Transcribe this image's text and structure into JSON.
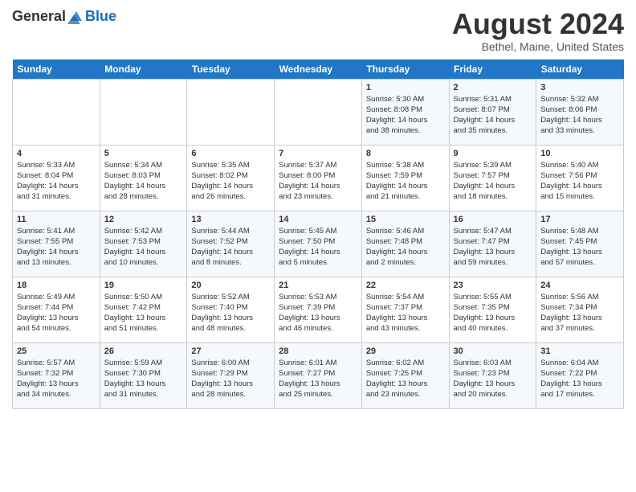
{
  "header": {
    "logo_general": "General",
    "logo_blue": "Blue",
    "month_title": "August 2024",
    "location": "Bethel, Maine, United States"
  },
  "weekdays": [
    "Sunday",
    "Monday",
    "Tuesday",
    "Wednesday",
    "Thursday",
    "Friday",
    "Saturday"
  ],
  "weeks": [
    [
      {
        "day": "",
        "info": ""
      },
      {
        "day": "",
        "info": ""
      },
      {
        "day": "",
        "info": ""
      },
      {
        "day": "",
        "info": ""
      },
      {
        "day": "1",
        "info": "Sunrise: 5:30 AM\nSunset: 8:08 PM\nDaylight: 14 hours\nand 38 minutes."
      },
      {
        "day": "2",
        "info": "Sunrise: 5:31 AM\nSunset: 8:07 PM\nDaylight: 14 hours\nand 35 minutes."
      },
      {
        "day": "3",
        "info": "Sunrise: 5:32 AM\nSunset: 8:06 PM\nDaylight: 14 hours\nand 33 minutes."
      }
    ],
    [
      {
        "day": "4",
        "info": "Sunrise: 5:33 AM\nSunset: 8:04 PM\nDaylight: 14 hours\nand 31 minutes."
      },
      {
        "day": "5",
        "info": "Sunrise: 5:34 AM\nSunset: 8:03 PM\nDaylight: 14 hours\nand 28 minutes."
      },
      {
        "day": "6",
        "info": "Sunrise: 5:35 AM\nSunset: 8:02 PM\nDaylight: 14 hours\nand 26 minutes."
      },
      {
        "day": "7",
        "info": "Sunrise: 5:37 AM\nSunset: 8:00 PM\nDaylight: 14 hours\nand 23 minutes."
      },
      {
        "day": "8",
        "info": "Sunrise: 5:38 AM\nSunset: 7:59 PM\nDaylight: 14 hours\nand 21 minutes."
      },
      {
        "day": "9",
        "info": "Sunrise: 5:39 AM\nSunset: 7:57 PM\nDaylight: 14 hours\nand 18 minutes."
      },
      {
        "day": "10",
        "info": "Sunrise: 5:40 AM\nSunset: 7:56 PM\nDaylight: 14 hours\nand 15 minutes."
      }
    ],
    [
      {
        "day": "11",
        "info": "Sunrise: 5:41 AM\nSunset: 7:55 PM\nDaylight: 14 hours\nand 13 minutes."
      },
      {
        "day": "12",
        "info": "Sunrise: 5:42 AM\nSunset: 7:53 PM\nDaylight: 14 hours\nand 10 minutes."
      },
      {
        "day": "13",
        "info": "Sunrise: 5:44 AM\nSunset: 7:52 PM\nDaylight: 14 hours\nand 8 minutes."
      },
      {
        "day": "14",
        "info": "Sunrise: 5:45 AM\nSunset: 7:50 PM\nDaylight: 14 hours\nand 5 minutes."
      },
      {
        "day": "15",
        "info": "Sunrise: 5:46 AM\nSunset: 7:48 PM\nDaylight: 14 hours\nand 2 minutes."
      },
      {
        "day": "16",
        "info": "Sunrise: 5:47 AM\nSunset: 7:47 PM\nDaylight: 13 hours\nand 59 minutes."
      },
      {
        "day": "17",
        "info": "Sunrise: 5:48 AM\nSunset: 7:45 PM\nDaylight: 13 hours\nand 57 minutes."
      }
    ],
    [
      {
        "day": "18",
        "info": "Sunrise: 5:49 AM\nSunset: 7:44 PM\nDaylight: 13 hours\nand 54 minutes."
      },
      {
        "day": "19",
        "info": "Sunrise: 5:50 AM\nSunset: 7:42 PM\nDaylight: 13 hours\nand 51 minutes."
      },
      {
        "day": "20",
        "info": "Sunrise: 5:52 AM\nSunset: 7:40 PM\nDaylight: 13 hours\nand 48 minutes."
      },
      {
        "day": "21",
        "info": "Sunrise: 5:53 AM\nSunset: 7:39 PM\nDaylight: 13 hours\nand 46 minutes."
      },
      {
        "day": "22",
        "info": "Sunrise: 5:54 AM\nSunset: 7:37 PM\nDaylight: 13 hours\nand 43 minutes."
      },
      {
        "day": "23",
        "info": "Sunrise: 5:55 AM\nSunset: 7:35 PM\nDaylight: 13 hours\nand 40 minutes."
      },
      {
        "day": "24",
        "info": "Sunrise: 5:56 AM\nSunset: 7:34 PM\nDaylight: 13 hours\nand 37 minutes."
      }
    ],
    [
      {
        "day": "25",
        "info": "Sunrise: 5:57 AM\nSunset: 7:32 PM\nDaylight: 13 hours\nand 34 minutes."
      },
      {
        "day": "26",
        "info": "Sunrise: 5:59 AM\nSunset: 7:30 PM\nDaylight: 13 hours\nand 31 minutes."
      },
      {
        "day": "27",
        "info": "Sunrise: 6:00 AM\nSunset: 7:29 PM\nDaylight: 13 hours\nand 28 minutes."
      },
      {
        "day": "28",
        "info": "Sunrise: 6:01 AM\nSunset: 7:27 PM\nDaylight: 13 hours\nand 25 minutes."
      },
      {
        "day": "29",
        "info": "Sunrise: 6:02 AM\nSunset: 7:25 PM\nDaylight: 13 hours\nand 23 minutes."
      },
      {
        "day": "30",
        "info": "Sunrise: 6:03 AM\nSunset: 7:23 PM\nDaylight: 13 hours\nand 20 minutes."
      },
      {
        "day": "31",
        "info": "Sunrise: 6:04 AM\nSunset: 7:22 PM\nDaylight: 13 hours\nand 17 minutes."
      }
    ]
  ]
}
